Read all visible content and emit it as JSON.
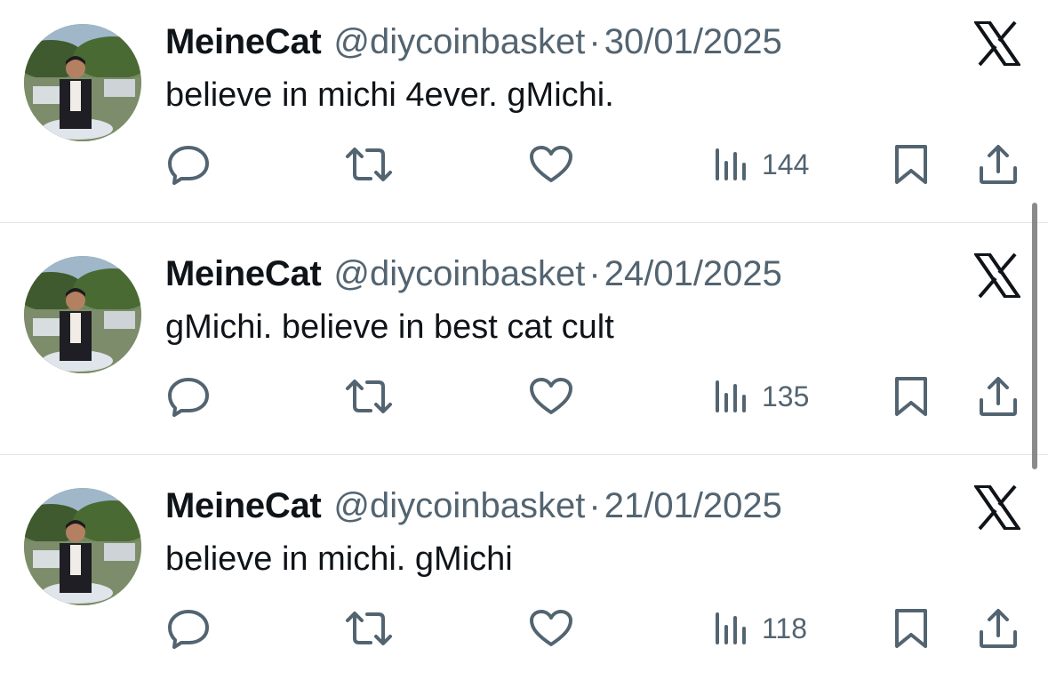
{
  "tweets": [
    {
      "name": "MeineCat",
      "handle": "@diycoinbasket",
      "separator": "·",
      "date": "30/01/2025",
      "text": "believe in michi 4ever. gMichi.",
      "views": "144"
    },
    {
      "name": "MeineCat",
      "handle": "@diycoinbasket",
      "separator": "·",
      "date": "24/01/2025",
      "text": "gMichi. believe in best cat cult",
      "views": "135"
    },
    {
      "name": "MeineCat",
      "handle": "@diycoinbasket",
      "separator": "·",
      "date": "21/01/2025",
      "text": "believe in michi. gMichi",
      "views": "118"
    }
  ],
  "icons": {
    "reply": "reply-icon",
    "retweet": "retweet-icon",
    "like": "heart-icon",
    "views": "views-icon",
    "bookmark": "bookmark-icon",
    "share": "share-icon",
    "logo": "x-logo-icon"
  },
  "colors": {
    "text": "#0f1419",
    "secondary": "#536471",
    "divider": "#e3e5e8"
  }
}
